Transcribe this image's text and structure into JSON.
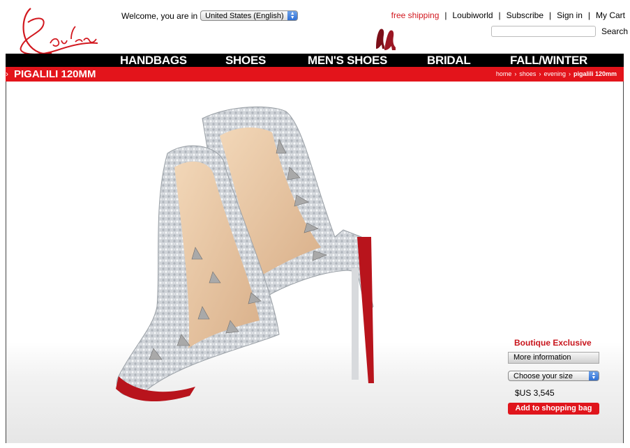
{
  "brand": {
    "logo_text": "Louboutin"
  },
  "header": {
    "welcome_text": "Welcome, you are in",
    "locale_value": "United States (English)",
    "links": [
      {
        "label": "free shipping"
      },
      {
        "label": "Loubiworld"
      },
      {
        "label": "Subscribe"
      },
      {
        "label": "Sign in"
      },
      {
        "label": "My Cart"
      }
    ],
    "search_label": "Search",
    "search_placeholder": ""
  },
  "nav": {
    "items": [
      "HANDBAGS",
      "SHOES",
      "MEN'S SHOES",
      "BRIDAL",
      "FALL/WINTER"
    ]
  },
  "product_bar": {
    "title": "PIGALILI 120MM",
    "breadcrumb": [
      "home",
      "shoes",
      "evening",
      "pigalili 120mm"
    ]
  },
  "purchase": {
    "boutique_label": "Boutique Exclusive",
    "more_info_label": "More information",
    "size_select_value": "Choose your size",
    "price": "$US 3,545",
    "add_button_label": "Add to shopping bag"
  },
  "icons": {
    "header_icon": "red-heels-icon",
    "select_arrow": "select-arrows-icon"
  },
  "colors": {
    "accent_red": "#e3141b",
    "nav_black": "#000000",
    "sole_red": "#c8141b"
  }
}
